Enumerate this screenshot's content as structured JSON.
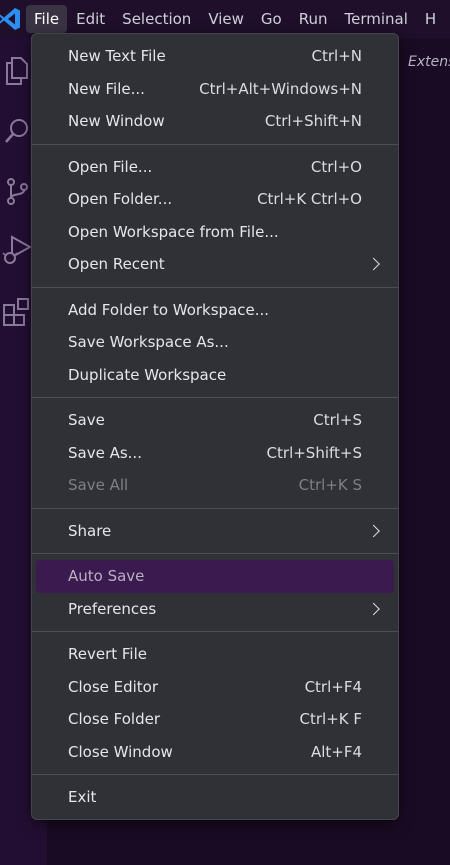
{
  "menubar": {
    "items": [
      "File",
      "Edit",
      "Selection",
      "View",
      "Go",
      "Run",
      "Terminal",
      "H"
    ],
    "active_index": 0
  },
  "activity_icons": [
    "explorer-icon",
    "search-icon",
    "source-control-icon",
    "run-debug-icon",
    "extensions-icon"
  ],
  "editor": {
    "hint_text": "Extens"
  },
  "colors": {
    "accent": "#3b1a4f",
    "menu_bg": "#2f3137",
    "vscode_blue": "#2b8ff0"
  },
  "menu": {
    "groups": [
      [
        {
          "label": "New Text File",
          "shortcut": "Ctrl+N"
        },
        {
          "label": "New File...",
          "shortcut": "Ctrl+Alt+Windows+N"
        },
        {
          "label": "New Window",
          "shortcut": "Ctrl+Shift+N"
        }
      ],
      [
        {
          "label": "Open File...",
          "shortcut": "Ctrl+O"
        },
        {
          "label": "Open Folder...",
          "shortcut": "Ctrl+K Ctrl+O"
        },
        {
          "label": "Open Workspace from File...",
          "shortcut": ""
        },
        {
          "label": "Open Recent",
          "shortcut": "",
          "submenu": true
        }
      ],
      [
        {
          "label": "Add Folder to Workspace...",
          "shortcut": ""
        },
        {
          "label": "Save Workspace As...",
          "shortcut": ""
        },
        {
          "label": "Duplicate Workspace",
          "shortcut": ""
        }
      ],
      [
        {
          "label": "Save",
          "shortcut": "Ctrl+S"
        },
        {
          "label": "Save As...",
          "shortcut": "Ctrl+Shift+S"
        },
        {
          "label": "Save All",
          "shortcut": "Ctrl+K S",
          "disabled": true
        }
      ],
      [
        {
          "label": "Share",
          "shortcut": "",
          "submenu": true
        }
      ],
      [
        {
          "label": "Auto Save",
          "shortcut": "",
          "highlighted": true
        },
        {
          "label": "Preferences",
          "shortcut": "",
          "submenu": true
        }
      ],
      [
        {
          "label": "Revert File",
          "shortcut": ""
        },
        {
          "label": "Close Editor",
          "shortcut": "Ctrl+F4"
        },
        {
          "label": "Close Folder",
          "shortcut": "Ctrl+K F"
        },
        {
          "label": "Close Window",
          "shortcut": "Alt+F4"
        }
      ],
      [
        {
          "label": "Exit",
          "shortcut": ""
        }
      ]
    ]
  }
}
